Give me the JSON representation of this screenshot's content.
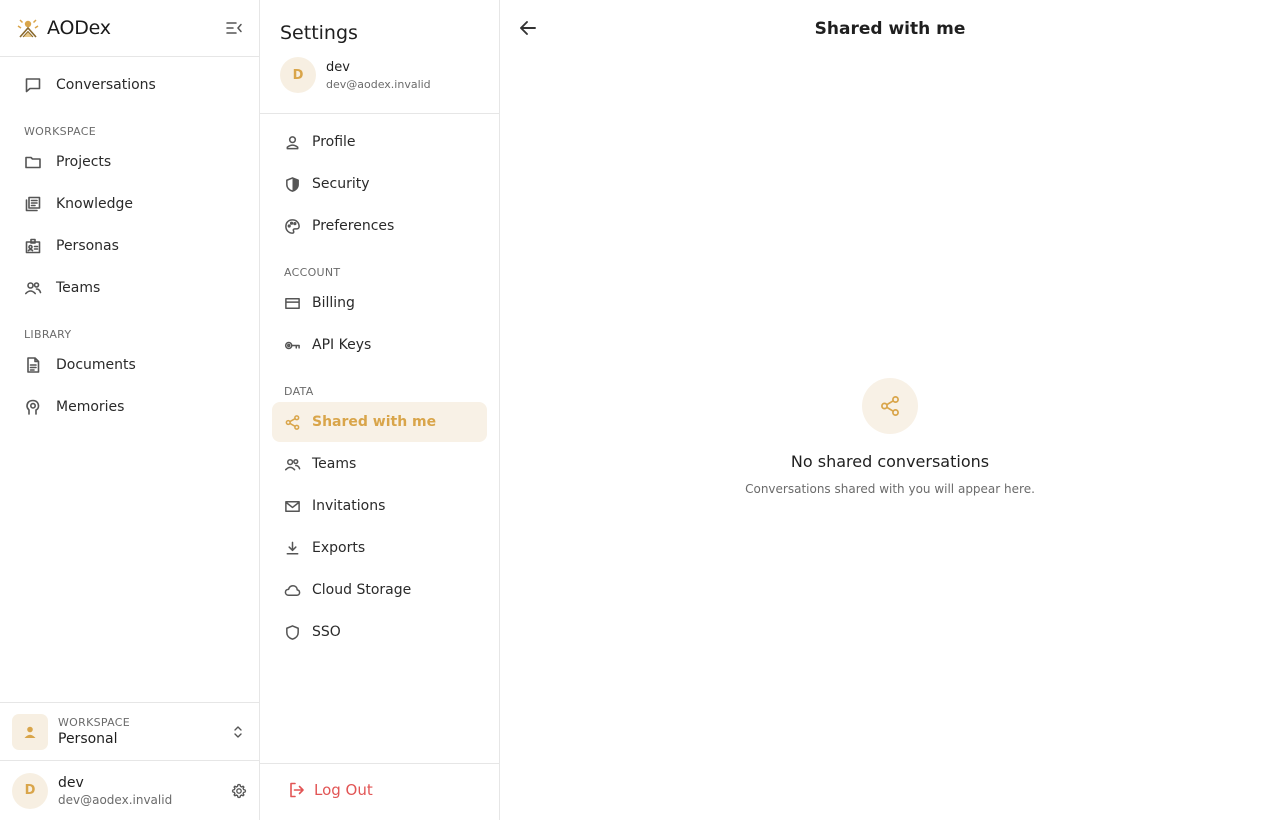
{
  "app": {
    "name": "AODex"
  },
  "sidebar": {
    "conversations_label": "Conversations",
    "workspace_section": "WORKSPACE",
    "workspace_items": [
      {
        "label": "Projects",
        "icon": "folder-icon"
      },
      {
        "label": "Knowledge",
        "icon": "library-icon"
      },
      {
        "label": "Personas",
        "icon": "id-badge-icon"
      },
      {
        "label": "Teams",
        "icon": "people-icon"
      }
    ],
    "library_section": "LIBRARY",
    "library_items": [
      {
        "label": "Documents",
        "icon": "document-icon"
      },
      {
        "label": "Memories",
        "icon": "brain-icon"
      }
    ],
    "workspace_switcher": {
      "caption": "WORKSPACE",
      "name": "Personal"
    },
    "user": {
      "initial": "D",
      "name": "dev",
      "email": "dev@aodex.invalid"
    }
  },
  "settings": {
    "title": "Settings",
    "user": {
      "initial": "D",
      "name": "dev",
      "email": "dev@aodex.invalid"
    },
    "general_items": [
      {
        "label": "Profile",
        "icon": "person-icon"
      },
      {
        "label": "Security",
        "icon": "shield-half-icon"
      },
      {
        "label": "Preferences",
        "icon": "palette-icon"
      }
    ],
    "account_section": "ACCOUNT",
    "account_items": [
      {
        "label": "Billing",
        "icon": "credit-card-icon"
      },
      {
        "label": "API Keys",
        "icon": "key-icon"
      }
    ],
    "data_section": "DATA",
    "data_items": [
      {
        "label": "Shared with me",
        "icon": "share-icon",
        "active": true
      },
      {
        "label": "Teams",
        "icon": "people-icon"
      },
      {
        "label": "Invitations",
        "icon": "mail-icon"
      },
      {
        "label": "Exports",
        "icon": "download-icon"
      },
      {
        "label": "Cloud Storage",
        "icon": "cloud-icon"
      },
      {
        "label": "SSO",
        "icon": "shield-icon"
      }
    ],
    "logout_label": "Log Out"
  },
  "main": {
    "title": "Shared with me",
    "empty_state": {
      "icon": "share-icon",
      "title": "No shared conversations",
      "subtitle": "Conversations shared with you will appear here."
    }
  },
  "colors": {
    "accent": "#d9a54a",
    "accent_bg": "#f8f1e6",
    "danger": "#e25555"
  }
}
